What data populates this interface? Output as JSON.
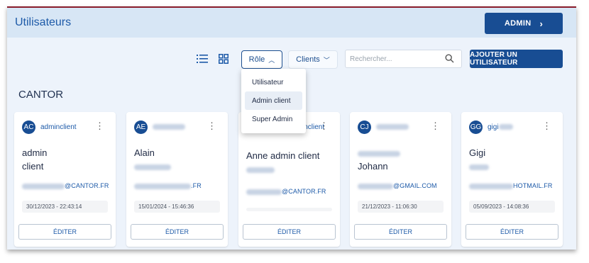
{
  "header": {
    "title": "Utilisateurs",
    "admin_label": "ADMIN"
  },
  "toolbar": {
    "role_label": "Rôle",
    "clients_label": "Clients",
    "search_placeholder": "Rechercher...",
    "add_label": "AJOUTER UN UTILISATEUR"
  },
  "role_menu": {
    "items": [
      "Utilisateur",
      "Admin client",
      "Super Admin"
    ],
    "highlighted": "Admin client"
  },
  "section": {
    "title": "CANTOR"
  },
  "cards": [
    {
      "initials": "AC",
      "username": "adminclient",
      "name_line1": "admin",
      "name_line2": "client",
      "email": "@CANTOR.FR",
      "date": "30/12/2023 - 22:43:14",
      "edit_label": "ÉDITER"
    },
    {
      "initials": "AE",
      "username": "",
      "name_line1": "Alain",
      "name_line2": "",
      "email": ".FR",
      "date": "15/01/2024 - 15:46:36",
      "edit_label": "ÉDITER"
    },
    {
      "initials": "",
      "username": "inclient",
      "name_line1": "Anne admin client",
      "name_line2": "",
      "email": "@CANTOR.FR",
      "date": "",
      "edit_label": "ÉDITER"
    },
    {
      "initials": "CJ",
      "username": "",
      "name_line1": "",
      "name_line2": "Johann",
      "email": "@GMAIL.COM",
      "date": "21/12/2023 - 11:06:30",
      "edit_label": "ÉDITER"
    },
    {
      "initials": "GG",
      "username": "gigi",
      "name_line1": "Gigi",
      "name_line2": "",
      "email": "HOTMAIL.FR",
      "date": "05/09/2023 - 14:08:36",
      "edit_label": "ÉDITER"
    }
  ]
}
